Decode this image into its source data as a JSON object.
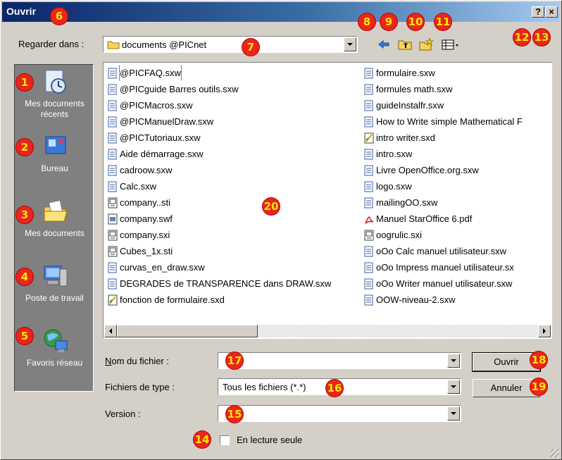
{
  "window": {
    "title": "Ouvrir",
    "help_label": "?",
    "close_label": "×"
  },
  "lookin": {
    "label": "Regarder dans :",
    "value": "documents @PICnet"
  },
  "toolbar": {
    "back": "back-arrow-icon",
    "up": "folder-up-icon",
    "new_folder": "new-folder-icon",
    "view_menu": "view-menu-icon"
  },
  "places": [
    {
      "label": "Mes documents récents",
      "icon": "recent-documents-icon"
    },
    {
      "label": "Bureau",
      "icon": "desktop-icon"
    },
    {
      "label": "Mes documents",
      "icon": "my-documents-icon"
    },
    {
      "label": "Poste de travail",
      "icon": "my-computer-icon"
    },
    {
      "label": "Favoris réseau",
      "icon": "network-places-icon"
    }
  ],
  "files": {
    "col1": [
      {
        "name": "@PICFAQ.sxw",
        "type": "doc"
      },
      {
        "name": "@PICguide Barres outils.sxw",
        "type": "doc"
      },
      {
        "name": "@PICMacros.sxw",
        "type": "doc"
      },
      {
        "name": "@PICManuelDraw.sxw",
        "type": "doc"
      },
      {
        "name": "@PICTutoriaux.sxw",
        "type": "doc"
      },
      {
        "name": "Aide démarrage.sxw",
        "type": "doc"
      },
      {
        "name": "cadroow.sxw",
        "type": "doc"
      },
      {
        "name": "Calc.sxw",
        "type": "doc"
      },
      {
        "name": "company..sti",
        "type": "pres"
      },
      {
        "name": "company.swf",
        "type": "swf"
      },
      {
        "name": "company.sxi",
        "type": "pres"
      },
      {
        "name": "Cubes_1x.sti",
        "type": "pres"
      },
      {
        "name": "curvas_en_draw.sxw",
        "type": "doc"
      },
      {
        "name": "DEGRADES de TRANSPARENCE dans DRAW.sxw",
        "type": "doc"
      },
      {
        "name": "fonction de formulaire.sxd",
        "type": "draw"
      }
    ],
    "col2": [
      {
        "name": "formulaire.sxw",
        "type": "doc"
      },
      {
        "name": "formules math.sxw",
        "type": "doc"
      },
      {
        "name": "guideInstalfr.sxw",
        "type": "doc"
      },
      {
        "name": "How to Write simple Mathematical F",
        "type": "doc"
      },
      {
        "name": "intro writer.sxd",
        "type": "draw"
      },
      {
        "name": "intro.sxw",
        "type": "doc"
      },
      {
        "name": "Livre OpenOffice.org.sxw",
        "type": "doc"
      },
      {
        "name": "logo.sxw",
        "type": "doc"
      },
      {
        "name": "mailingOO.sxw",
        "type": "doc"
      },
      {
        "name": "Manuel StarOffice 6.pdf",
        "type": "pdf"
      },
      {
        "name": "oogrulic.sxi",
        "type": "pres"
      },
      {
        "name": "oOo Calc  manuel utilisateur.sxw",
        "type": "doc"
      },
      {
        "name": "oOo Impress  manuel utilisateur.sx",
        "type": "doc"
      },
      {
        "name": "oOo Writer manuel utilisateur.sxw",
        "type": "doc"
      },
      {
        "name": "OOW-niveau-2.sxw",
        "type": "doc"
      }
    ]
  },
  "form": {
    "filename_label": "Nom du fichier :",
    "filename_value": "",
    "filetype_label": "Fichiers de type :",
    "filetype_value": "Tous les fichiers (*.*)",
    "version_label": "Version :",
    "version_value": "",
    "readonly_label": "En lecture seule"
  },
  "buttons": {
    "open": "Ouvrir",
    "cancel": "Annuler"
  },
  "annotations": [
    "1",
    "2",
    "3",
    "4",
    "5",
    "6",
    "7",
    "8",
    "9",
    "10",
    "11",
    "12",
    "13",
    "14",
    "15",
    "16",
    "17",
    "18",
    "19",
    "20"
  ],
  "colors": {
    "face": "#d4d0c8",
    "title_start": "#0a246a",
    "places_bg": "#808080",
    "badge": "#e8261c",
    "badge_text": "#ffe600"
  }
}
